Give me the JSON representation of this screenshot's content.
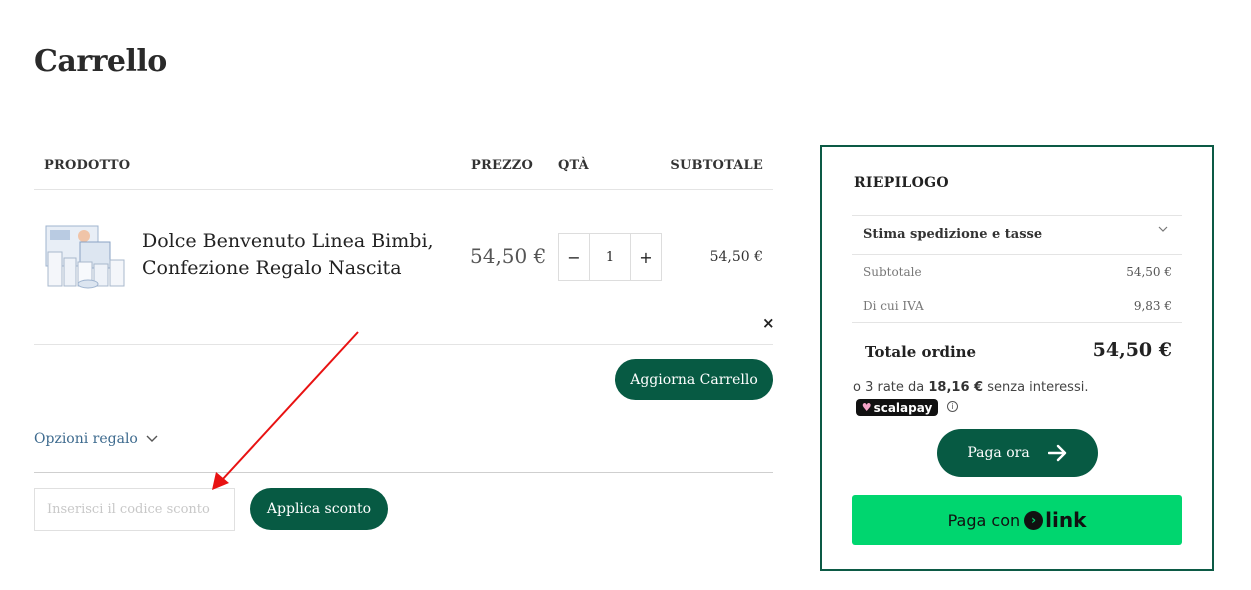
{
  "page": {
    "title": "Carrello"
  },
  "table": {
    "headers": {
      "product": "PRODOTTO",
      "price": "PREZZO",
      "qty": "QTÀ",
      "subtotal": "SUBTOTALE"
    },
    "item": {
      "name_line1": "Dolce Benvenuto Linea Bimbi,",
      "name_line2": "Confezione Regalo Nascita",
      "price": "54,50 €",
      "qty": "1",
      "qty_minus": "−",
      "qty_plus": "+",
      "subtotal": "54,50 €",
      "remove": "×"
    }
  },
  "actions": {
    "update_cart": "Aggiorna Carrello"
  },
  "gift": {
    "label": "Opzioni regalo"
  },
  "coupon": {
    "placeholder": "Inserisci il codice sconto",
    "apply": "Applica sconto"
  },
  "summary": {
    "title": "RIEPILOGO",
    "shipping_label": "Stima spedizione e tasse",
    "rows": [
      {
        "label": "Subtotale",
        "value": "54,50 €"
      },
      {
        "label": "Di cui IVA",
        "value": "9,83 €"
      }
    ],
    "total_label": "Totale ordine",
    "total_value": "54,50 €",
    "installments_prefix": "o 3 rate da",
    "installments_amount": "18,16 €",
    "installments_suffix": "senza interessi.",
    "scalapay_badge": "scalapay",
    "pay_now": "Paga ora",
    "pay_with": "Paga con",
    "link_brand": "link"
  }
}
